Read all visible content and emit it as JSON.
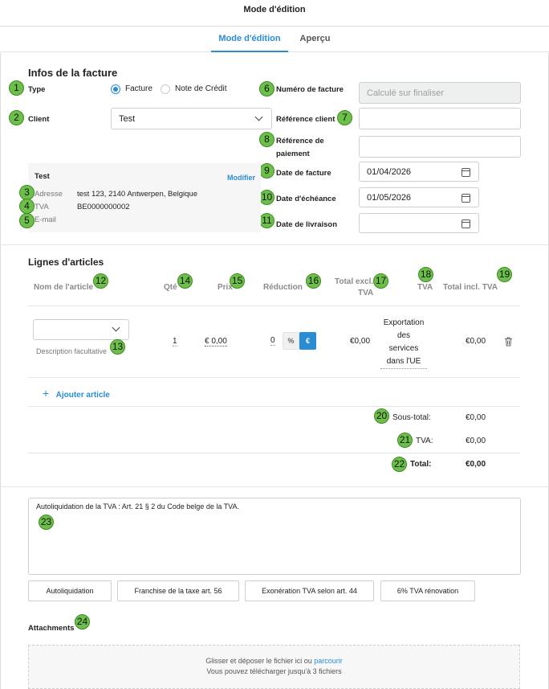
{
  "header": {
    "title": "Mode d'édition"
  },
  "tabs": [
    {
      "label": "Mode d'édition"
    },
    {
      "label": "Aperçu"
    }
  ],
  "invoice_info": {
    "title": "Infos de la facture",
    "type_label": "Type",
    "type_options": [
      "Facture",
      "Note de Crédit"
    ],
    "type_selected": "Facture",
    "client_label": "Client",
    "client_value": "Test",
    "invoice_number_label": "Numéro de facture",
    "invoice_number_placeholder": "Calculé sur finaliser",
    "client_ref_label": "Référence client",
    "payment_ref_label_1": "Référence de",
    "payment_ref_label_2": "paiement",
    "invoice_date_label": "Date de facture",
    "invoice_date_value": "01/04/2026",
    "due_date_label": "Date d'échéance",
    "due_date_value": "01/05/2026",
    "delivery_date_label": "Date de livraison"
  },
  "client_card": {
    "name": "Test",
    "edit_label": "Modifier",
    "address_label": "Adresse",
    "address_value": "test 123, 2140 Antwerpen, Belgique",
    "vat_label": "TVA",
    "vat_value": "BE0000000002",
    "email_label": "E-mail"
  },
  "lines": {
    "title": "Lignes d'articles",
    "headers": {
      "name": "Nom de l'article",
      "qty": "Qté",
      "price": "Prix",
      "discount": "Réduction",
      "total_excl_1": "Total excl.",
      "total_excl_2": "TVA",
      "vat": "TVA",
      "total_incl": "Total incl. TVA"
    },
    "row": {
      "description_placeholder": "Description facultative",
      "qty": "1",
      "price": "€ 0,00",
      "discount": "0",
      "discount_pct": "%",
      "discount_eur": "€",
      "total_excl": "€0,00",
      "vat": [
        "Exportation",
        "des",
        "services",
        "dans l'UE"
      ],
      "total_incl": "€0,00"
    },
    "add_label": "Ajouter article",
    "subtotal_label": "Sous-total:",
    "subtotal_value": "€0,00",
    "vat_label": "TVA:",
    "vat_value": "€0,00",
    "total_label": "Total:",
    "total_value": "€0,00"
  },
  "notes": {
    "text": "Autoliquidation de la TVA : Art. 21 § 2 du Code belge de la TVA.",
    "buttons": [
      "Autoliquidation",
      "Franchise de la taxe art. 56",
      "Exonération TVA selon art. 44",
      "6% TVA rénovation"
    ]
  },
  "attachments": {
    "title": "Attachments",
    "drop_text": "Glisser et déposer le fichier ici ou ",
    "browse_label": "parcourir",
    "limit_text": "Vous pouvez télécharger jusqu'à 3 fichiers"
  },
  "badges": [
    "1",
    "2",
    "3",
    "4",
    "5",
    "6",
    "7",
    "8",
    "9",
    "10",
    "11",
    "12",
    "13",
    "14",
    "15",
    "16",
    "17",
    "18",
    "19",
    "20",
    "21",
    "22",
    "23",
    "24"
  ],
  "colors": {
    "accent": "#2a8dd4",
    "badge": "#6cc04a"
  }
}
